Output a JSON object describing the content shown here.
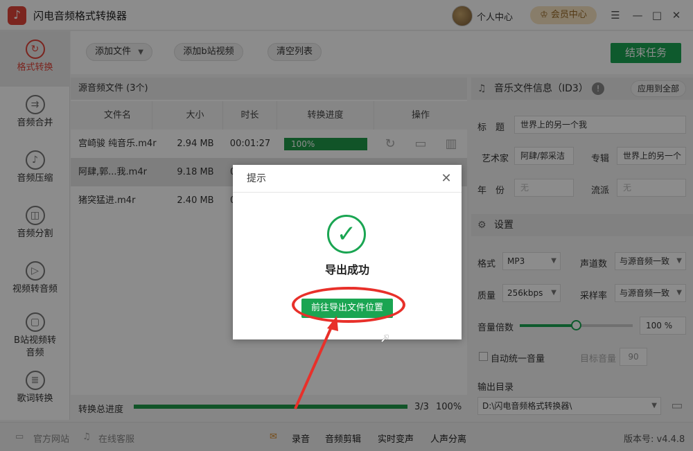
{
  "app": {
    "title": "闪电音频格式转换器",
    "logo_glyph": "♪"
  },
  "header": {
    "user_center": "个人中心",
    "vip": "♔ 会员中心",
    "menu": "☰",
    "minimize": "—",
    "maximize": "□",
    "close": "✕"
  },
  "sidebar": {
    "items": [
      {
        "label": "格式转换",
        "icon": "↻",
        "active": true
      },
      {
        "label": "音频合并",
        "icon": "⇉"
      },
      {
        "label": "音频压缩",
        "icon": "♪"
      },
      {
        "label": "音频分割",
        "icon": "◫"
      },
      {
        "label": "视频转音频",
        "icon": "▷"
      },
      {
        "label": "B站视频转",
        "label2": "音频",
        "icon": "▢"
      },
      {
        "label": "歌词转换",
        "icon": "≣"
      }
    ]
  },
  "toolbar": {
    "add_file": "添加文件",
    "add_bili": "添加b站视频",
    "clear": "清空列表",
    "end_task": "结束任务"
  },
  "table": {
    "title": "源音频文件 (3个)",
    "headers": [
      "文件名",
      "大小",
      "时长",
      "转换进度",
      "操作"
    ],
    "rows": [
      {
        "name": "宫崎骏 纯音乐.m4r",
        "size": "2.94 MB",
        "duration": "00:01:27",
        "progress": "100%"
      },
      {
        "name": "阿肆,郭...我.m4r",
        "size": "9.18 MB",
        "duration": "0",
        "progress": ""
      },
      {
        "name": "猪突猛进.m4r",
        "size": "2.40 MB",
        "duration": "0",
        "progress": ""
      }
    ],
    "total_label": "转换总进度",
    "total_count": "3/3",
    "total_percent": "100%"
  },
  "info": {
    "title": "音乐文件信息（ID3）",
    "apply_all": "应用到全部",
    "title_label": "标　题",
    "title_value": "世界上的另一个我",
    "artist_label": "艺术家",
    "artist_value": "阿肆/郭采洁",
    "album_label": "专辑",
    "album_value": "世界上的另一个",
    "year_label": "年　份",
    "year_value": "无",
    "genre_label": "流派",
    "genre_value": "无"
  },
  "settings": {
    "title": "设置",
    "format_label": "格式",
    "format_value": "MP3",
    "channels_label": "声道数",
    "channels_value": "与源音频一致",
    "quality_label": "质量",
    "quality_value": "256kbps",
    "samplerate_label": "采样率",
    "samplerate_value": "与源音频一致",
    "volume_label": "音量倍数",
    "volume_value": "100",
    "volume_unit": "%",
    "auto_volume": "自动统一音量",
    "target_volume_label": "目标音量",
    "target_volume_value": "90",
    "output_label": "输出目录",
    "output_value": "D:\\闪电音频格式转换器\\"
  },
  "statusbar": {
    "website": "官方网站",
    "support": "在线客服",
    "record": "录音",
    "clip": "音频剪辑",
    "voice": "实时变声",
    "separate": "人声分离",
    "version": "版本号: v4.4.8"
  },
  "dialog": {
    "title": "提示",
    "message": "导出成功",
    "button": "前往导出文件位置"
  },
  "colors": {
    "accent": "#1aa552",
    "brand": "#e0443a",
    "annotation": "#e8302a"
  }
}
